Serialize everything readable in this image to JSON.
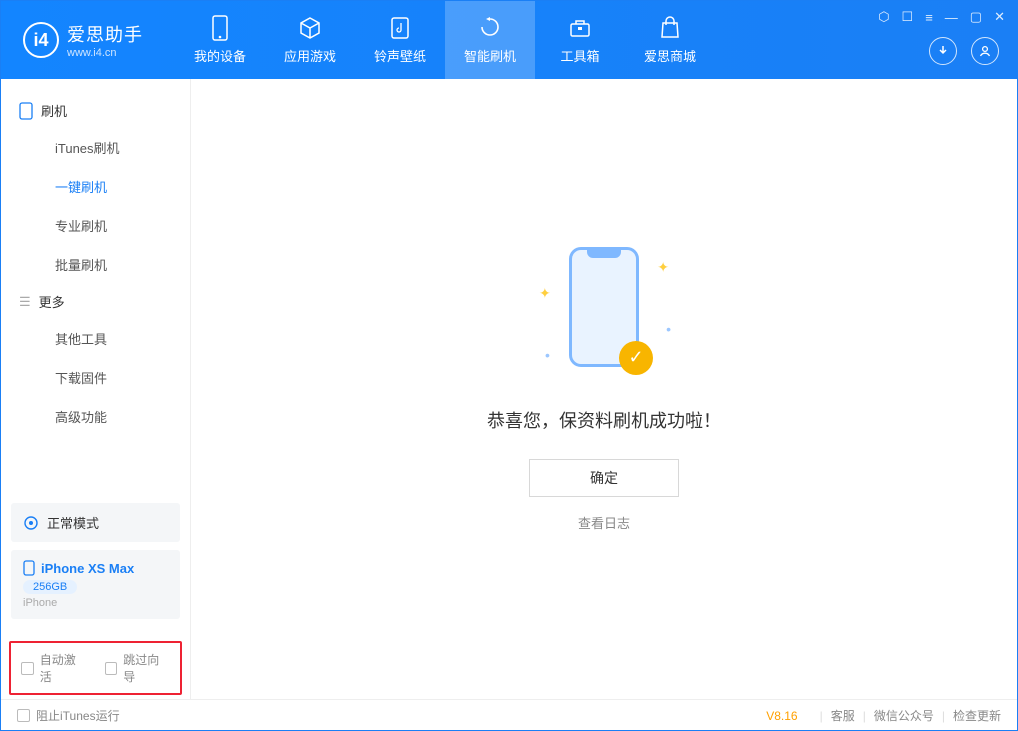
{
  "app": {
    "name": "爱思助手",
    "domain": "www.i4.cn",
    "logo_letter": "i4"
  },
  "nav": {
    "items": [
      {
        "label": "我的设备"
      },
      {
        "label": "应用游戏"
      },
      {
        "label": "铃声壁纸"
      },
      {
        "label": "智能刷机"
      },
      {
        "label": "工具箱"
      },
      {
        "label": "爱思商城"
      }
    ]
  },
  "sidebar": {
    "section1": {
      "title": "刷机"
    },
    "items1": [
      {
        "label": "iTunes刷机"
      },
      {
        "label": "一键刷机"
      },
      {
        "label": "专业刷机"
      },
      {
        "label": "批量刷机"
      }
    ],
    "section2": {
      "title": "更多"
    },
    "items2": [
      {
        "label": "其他工具"
      },
      {
        "label": "下载固件"
      },
      {
        "label": "高级功能"
      }
    ]
  },
  "device": {
    "mode": "正常模式",
    "name": "iPhone XS Max",
    "capacity": "256GB",
    "type": "iPhone"
  },
  "checks": {
    "auto_activate": "自动激活",
    "skip_guide": "跳过向导"
  },
  "main": {
    "success": "恭喜您，保资料刷机成功啦！",
    "ok": "确定",
    "view_log": "查看日志"
  },
  "footer": {
    "block_itunes": "阻止iTunes运行",
    "version": "V8.16",
    "service": "客服",
    "wechat": "微信公众号",
    "update": "检查更新"
  }
}
